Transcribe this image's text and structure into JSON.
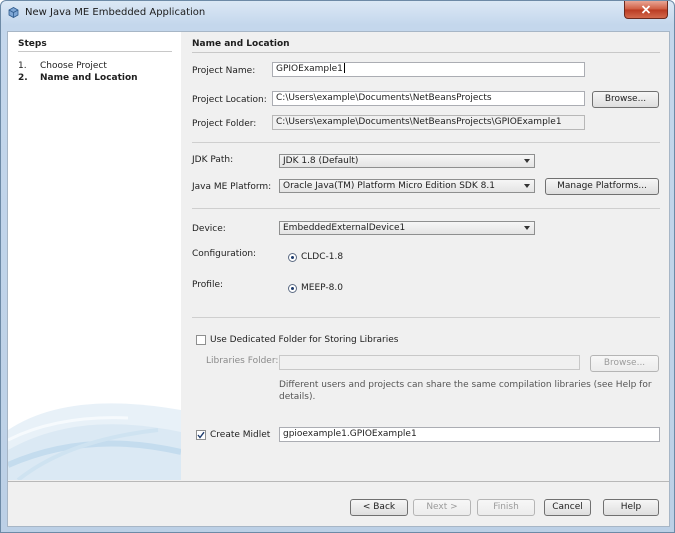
{
  "window": {
    "title": "New Java ME Embedded Application"
  },
  "steps": {
    "title": "Steps",
    "items": [
      {
        "num": "1.",
        "label": "Choose Project"
      },
      {
        "num": "2.",
        "label": "Name and Location"
      }
    ]
  },
  "panel": {
    "title": "Name and Location",
    "project_name_label": "Project Name:",
    "project_name_value": "GPIOExample1",
    "project_location_label": "Project Location:",
    "project_location_value": "C:\\Users\\example\\Documents\\NetBeansProjects",
    "browse_label": "Browse...",
    "project_folder_label": "Project Folder:",
    "project_folder_value": "C:\\Users\\example\\Documents\\NetBeansProjects\\GPIOExample1",
    "jdk_label": "JDK Path:",
    "jdk_value": "JDK 1.8 (Default)",
    "platform_label": "Java ME Platform:",
    "platform_value": "Oracle Java(TM) Platform Micro Edition SDK 8.1",
    "manage_platforms_label": "Manage Platforms...",
    "device_label": "Device:",
    "device_value": "EmbeddedExternalDevice1",
    "configuration_label": "Configuration:",
    "configuration_value": "CLDC-1.8",
    "profile_label": "Profile:",
    "profile_value": "MEEP-8.0",
    "dedicated_folder_label": "Use Dedicated Folder for Storing Libraries",
    "dedicated_folder_checked": false,
    "libraries_folder_label": "Libraries Folder:",
    "libraries_folder_value": "",
    "libraries_browse_label": "Browse...",
    "libraries_help_line1": "Different users and projects can share the same compilation libraries (see Help for",
    "libraries_help_line2": "details).",
    "create_midlet_label": "Create Midlet",
    "create_midlet_checked": true,
    "midlet_value": "gpioexample1.GPIOExample1"
  },
  "buttons": {
    "back": "< Back",
    "next": "Next >",
    "finish": "Finish",
    "cancel": "Cancel",
    "help": "Help"
  }
}
